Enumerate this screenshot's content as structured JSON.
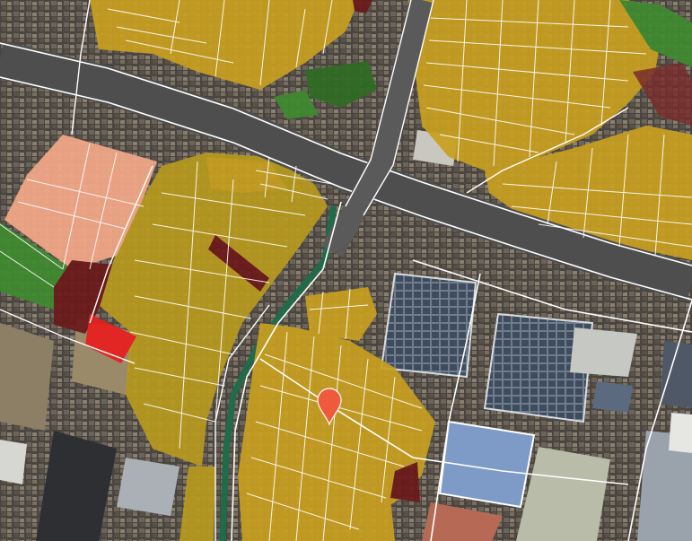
{
  "map": {
    "legend": {
      "residential": "#c8a020",
      "commercial": "#f4a888",
      "green_space": "#3f8a2f",
      "public_land": "#6b1a1a",
      "hazard": "#e81e1e",
      "industrial_roof": "#7a8796",
      "water_canal": "#1f6b4a"
    },
    "marker": {
      "icon": "map-pin-icon",
      "color": "#f05a3c"
    }
  }
}
